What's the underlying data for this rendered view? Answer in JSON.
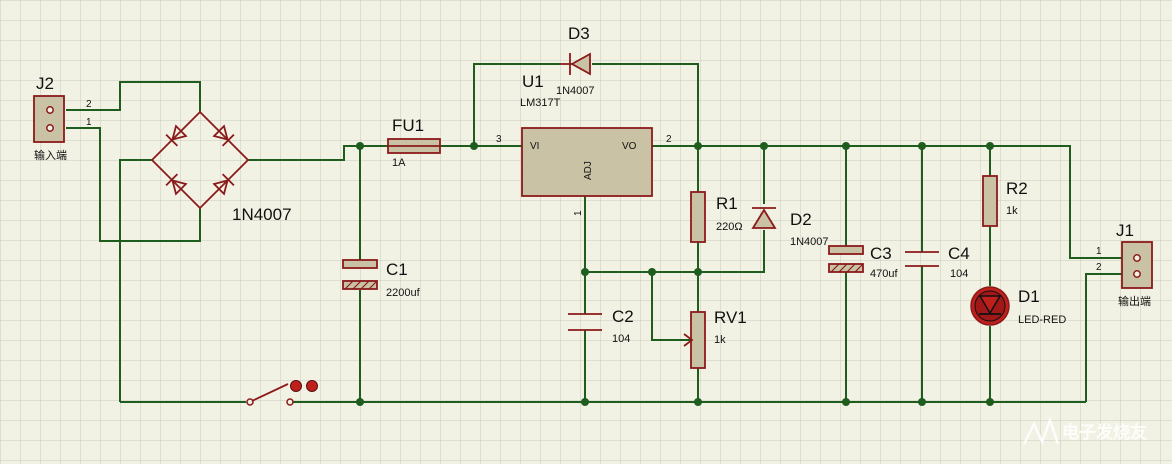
{
  "labels": {
    "j2": "J2",
    "j2_pin2": "2",
    "j2_pin1": "1",
    "j2_desc": "输入端",
    "bridge": "1N4007",
    "fu1": "FU1",
    "fu1_val": "1A",
    "u1": "U1",
    "u1_val": "LM317T",
    "u1_vi": "VI",
    "u1_vo": "VO",
    "u1_adj": "ADJ",
    "u1_pin3": "3",
    "u1_pin2": "2",
    "u1_pin1": "1",
    "d3": "D3",
    "d3_val": "1N4007",
    "c1": "C1",
    "c1_val": "2200uf",
    "r1": "R1",
    "r1_val": "220Ω",
    "d2": "D2",
    "d2_val": "1N4007",
    "c2": "C2",
    "c2_val": "104",
    "rv1": "RV1",
    "rv1_val": "1k",
    "c3": "C3",
    "c3_val": "470uf",
    "c4": "C4",
    "c4_val": "104",
    "r2": "R2",
    "r2_val": "1k",
    "d1": "D1",
    "d1_val": "LED-RED",
    "j1": "J1",
    "j1_pin1": "1",
    "j1_pin2": "2",
    "j1_desc": "输出端",
    "watermark": "电子发烧友"
  },
  "colors": {
    "background": "#f2f2e4",
    "grid": "#c8c8bd",
    "wire": "#1f5d1f",
    "component": "#8b1a1a",
    "component_fill": "#c9c2a4",
    "led": "#c0201c"
  }
}
